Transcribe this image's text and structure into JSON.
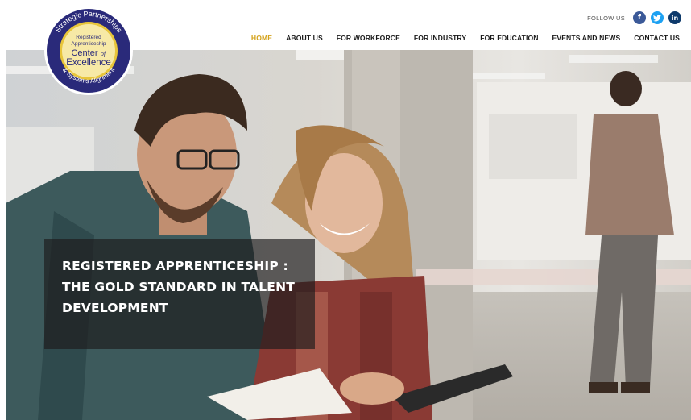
{
  "logo": {
    "arc_top": "Strategic Partnerships",
    "arc_bottom": "& Systems Alignment",
    "line1": "Registered",
    "line2": "Apprenticeship",
    "line3": "Center",
    "line3b": "of",
    "line4": "Excellence"
  },
  "header": {
    "follow_label": "FOLLOW US",
    "social": [
      {
        "glyph": "f",
        "icon": "facebook-icon"
      },
      {
        "glyph": "t",
        "icon": "twitter-icon"
      },
      {
        "glyph": "in",
        "icon": "linkedin-icon"
      }
    ]
  },
  "nav": {
    "items": [
      {
        "label": "HOME",
        "active": true
      },
      {
        "label": "ABOUT US"
      },
      {
        "label": "FOR WORKFORCE"
      },
      {
        "label": "FOR INDUSTRY"
      },
      {
        "label": "FOR EDUCATION"
      },
      {
        "label": "EVENTS AND NEWS"
      },
      {
        "label": "CONTACT US"
      }
    ]
  },
  "hero": {
    "title": "REGISTERED APPRENTICESHIP : THE GOLD STANDARD IN TALENT DEVELOPMENT"
  },
  "colors": {
    "accent": "#d4a21a",
    "logo_navy": "#2a2a7a",
    "facebook": "#3b5998",
    "twitter": "#1da1f2",
    "linkedin": "#0e3a6b"
  }
}
